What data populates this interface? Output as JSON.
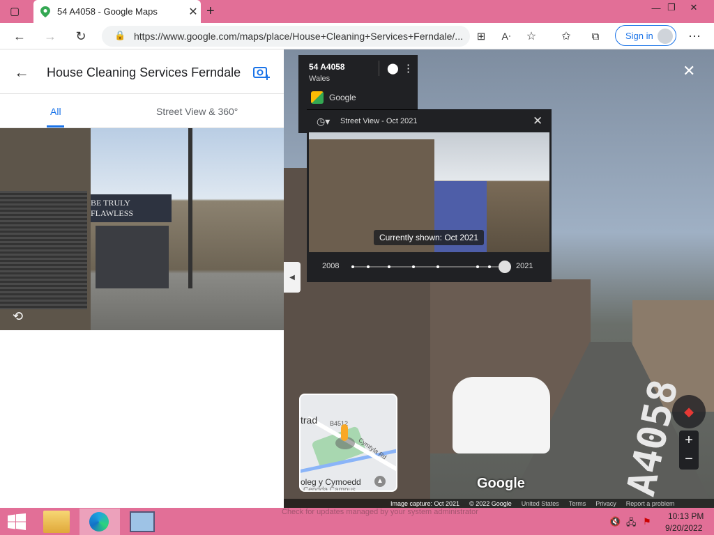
{
  "browser": {
    "tab_title": "54 A4058 - Google Maps",
    "url": "https://www.google.com/maps/place/House+Cleaning+Services+Ferndale/...",
    "sign_in_label": "Sign in"
  },
  "sidebar": {
    "title": "House Cleaning Services Ferndale",
    "tabs": [
      {
        "label": "All",
        "active": true
      },
      {
        "label": "Street View & 360°",
        "active": false
      }
    ],
    "photo_shop_sign": "BE TRULY FLAWLESS"
  },
  "street_view": {
    "info": {
      "address": "54 A4058",
      "region": "Wales",
      "source": "Google"
    },
    "time_travel": {
      "header": "Street View - Oct 2021",
      "tooltip": "Currently shown: Oct 2021",
      "start_year": "2008",
      "end_year": "2021",
      "points": [
        0,
        0.1,
        0.24,
        0.4,
        0.56,
        0.82,
        0.9,
        1.0
      ],
      "selected_index": 7
    },
    "road_marking": "A4058",
    "minimap": {
      "labels": [
        "trad",
        "B4512",
        "Cymtyla Rd",
        "oleg y Cymoedd",
        "Cendda Campus"
      ]
    },
    "watermark": "Google",
    "footer": {
      "capture": "Image capture: Oct 2021",
      "copyright": "© 2022 Google",
      "links": [
        "United States",
        "Terms",
        "Privacy",
        "Report a problem"
      ]
    }
  },
  "taskbar": {
    "notice": "Check for updates managed by your system administrator",
    "time": "10:13 PM",
    "date": "9/20/2022"
  },
  "colors": {
    "accent": "#1a73e8",
    "titlebar": "#e26f97",
    "card": "#202124"
  }
}
